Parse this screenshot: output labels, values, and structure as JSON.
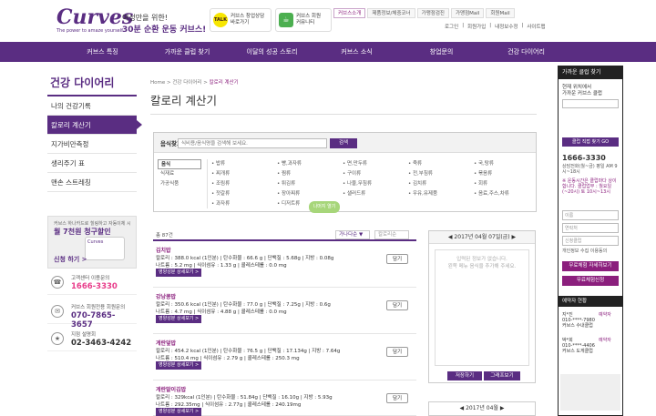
{
  "header": {
    "logo": "Curves",
    "logo_sub": "The power to amaze yourself.",
    "tagline1": "여성만을 위한!",
    "tagline2": "30분 순환 운동 커브스!",
    "kakao_icon": "TALK",
    "kakao": "커브스 창업상담\n바로가기",
    "cafe": "커브스 회원\n커뮤니티",
    "top_links": [
      "커브스소개",
      "제품정보/체중코너",
      "가맹점검진",
      "가맹점Mail",
      "회원Mail"
    ],
    "sub_links": [
      "로그인",
      "|",
      "회원가입",
      "|",
      "내정보수정",
      "|",
      "사이트맵"
    ]
  },
  "nav": [
    "커브스 특징",
    "가까운 클럽 찾기",
    "이달의 성공 스토리",
    "커브스 소식",
    "창업문의",
    "건강 다이어리"
  ],
  "left_sidebar": {
    "title": "건강 다이어리",
    "items": [
      "나의 건강기록",
      "칼로리 계산기",
      "지가비만측정",
      "생리주기 표",
      "맨손 스트레칭"
    ],
    "banner": {
      "small": "커브스 하나카드로 힐링하고 자동이체 시",
      "big": "월 7천원 청구할인",
      "card": "Curves",
      "btn": "신청 하기 >"
    },
    "contacts": [
      {
        "label": "고객센터 이용문의",
        "number": "1666-3330",
        "icon": "☎"
      },
      {
        "label": "커브스 회원전용 회원문의",
        "number": "070-7865-3657",
        "icon": "✉"
      },
      {
        "label": "지점 설명회",
        "number": "02-3463-4242",
        "icon": "★"
      }
    ]
  },
  "breadcrumb": [
    "Home",
    ">",
    "건강 다이어리",
    ">",
    "칼로리 계산기"
  ],
  "page_title": "칼로리 계산기",
  "search": {
    "label": "음식찾기",
    "placeholder": "식비용/음식명을 검색해 보세요.",
    "button": "검색",
    "categories": [
      "음식",
      "식재료",
      "가공식품"
    ],
    "foods": [
      "밥류",
      "빵,과자류",
      "면,만두류",
      "죽류",
      "국,탕류",
      "찌개류",
      "찜류",
      "구이류",
      "전,부침류",
      "볶음류",
      "조림류",
      "튀김류",
      "나물,무침류",
      "김치류",
      "회류",
      "젓갈류",
      "장아찌류",
      "샐러드류",
      "우유,유제품",
      "음료,주스,차류",
      "과자류",
      "디저트류",
      "",
      "",
      ""
    ],
    "scroll_tab": "나머지 열기"
  },
  "results": {
    "count": "총 87건",
    "sort1": "가나다순 ▼",
    "sort2": "칼로리순",
    "detail_btn": "영양성분 상세보기 >",
    "add_btn": "담기",
    "items": [
      {
        "name": "김치밥",
        "line1": "칼로리 : 388.0 kcal (1인분)  |  탄수화물 : 66.6 g  |  단백질 : 5.68g  |  지방 : 0.08g",
        "line2": "나트륨 : 5.2 mg  |  식이섬유 : 1.33 g  |  콜레스테롤 : 0.0 mg"
      },
      {
        "name": "강낭콩밥",
        "line1": "칼로리 : 350.6 kcal (1인분)  |  탄수화물 : 77.0 g  |  단백질 : 7.25g  |  지방 : 0.6g",
        "line2": "나트륨 : 4.7 mg  |  식이섬유 : 4.88 g  |  콜레스테롤 : 0.0 mg"
      },
      {
        "name": "게란덮밥",
        "line1": "칼로리 : 454.2 kcal (1인분)  |  탄수화물 : 76.5 g  |  단백질 : 17.134g  |  지방 : 7.64g",
        "line2": "나트륨 : 510.4 mg  |  식이섬유 : 2.79 g  |  콜레스테롤 : 250.3 mg"
      },
      {
        "name": "게란말이김밥",
        "line1": "칼로리 : 329kcal (1인분)  |  탄수화물 : 51.84g  |  단백질 : 16.10g  |  지방 : 5.93g",
        "line2": "나트륨 : 292.35mg  |  식이섬유 : 2.77g  |  콜레스테롤 : 240.19mg"
      }
    ]
  },
  "calendar": {
    "header": "◀   2017년 04월 07일(금)   ▶",
    "empty_text": "입력된 정보가 없습니다.\n왼쪽 메뉴 음식을 추가해 주세요.",
    "save_btn": "저장하기",
    "graph_btn": "그래프보기",
    "header2": "◀   2017년 04월   ▶"
  },
  "right_sidebar": {
    "title": "가까운 클럽 찾기",
    "desc": "현재 위치에서\n가까운 커브스 클럽",
    "go_btn": "클럽 직접 찾기 GO",
    "tel": "1666-3330",
    "tel_sub": "상담전화(월~금)\n평일 AM 9시~18시",
    "notice": "※ 운동시간은 클럽마다 상이합니다.\n클럽업무 : 월요일(~20시)\n토 10시~13시",
    "name_ph": "이름",
    "phone_ph": "연락처",
    "branch_ph": "신청클럽",
    "agree": "개인정보 수집 이용동의",
    "apply_btn": "무료체험 자세히보기",
    "apply_btn2": "무료체험신청",
    "review_title": "예약자 현황",
    "reviews": [
      "지*진\n010-****-7980\n커브스 수내클럽",
      "박*희\n010-****-4406\n커브스 도게클럽"
    ],
    "review_badge": "예약자"
  }
}
